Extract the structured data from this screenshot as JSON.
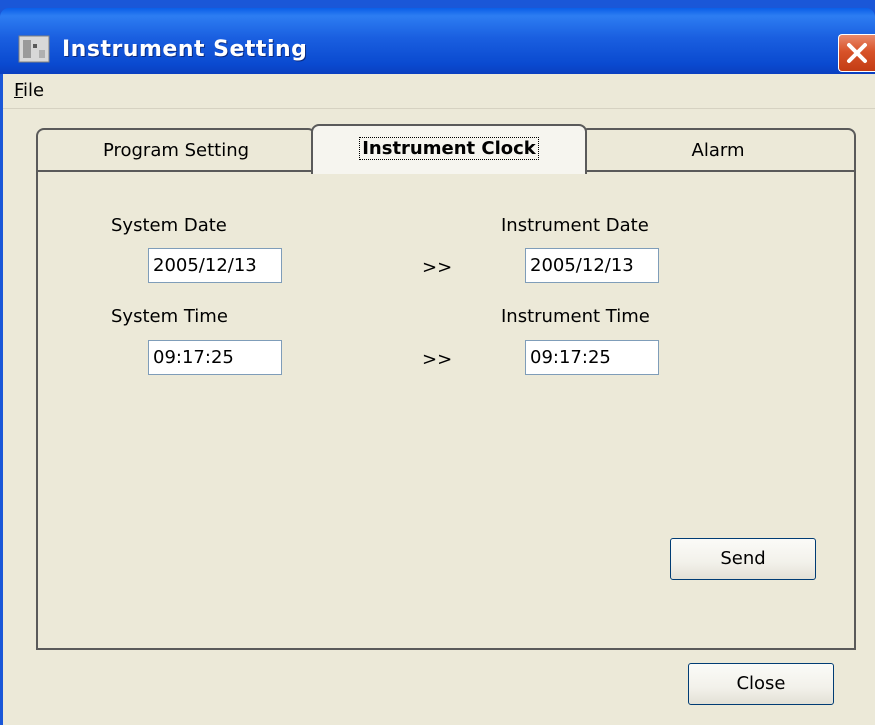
{
  "window": {
    "title": "Instrument Setting"
  },
  "menu": {
    "file_accel": "F",
    "file_rest": "ile"
  },
  "tabs": [
    {
      "label": "Program Setting"
    },
    {
      "label": "Instrument Clock"
    },
    {
      "label": "Alarm"
    }
  ],
  "clock": {
    "system_date_label": "System Date",
    "system_date_value": "2005/12/13",
    "system_time_label": "System Time",
    "system_time_value": "09:17:25",
    "instrument_date_label": "Instrument Date",
    "instrument_date_value": "2005/12/13",
    "instrument_time_label": "Instrument Time",
    "instrument_time_value": "09:17:25",
    "arrow": ">>"
  },
  "buttons": {
    "send": "Send",
    "close": "Close"
  }
}
